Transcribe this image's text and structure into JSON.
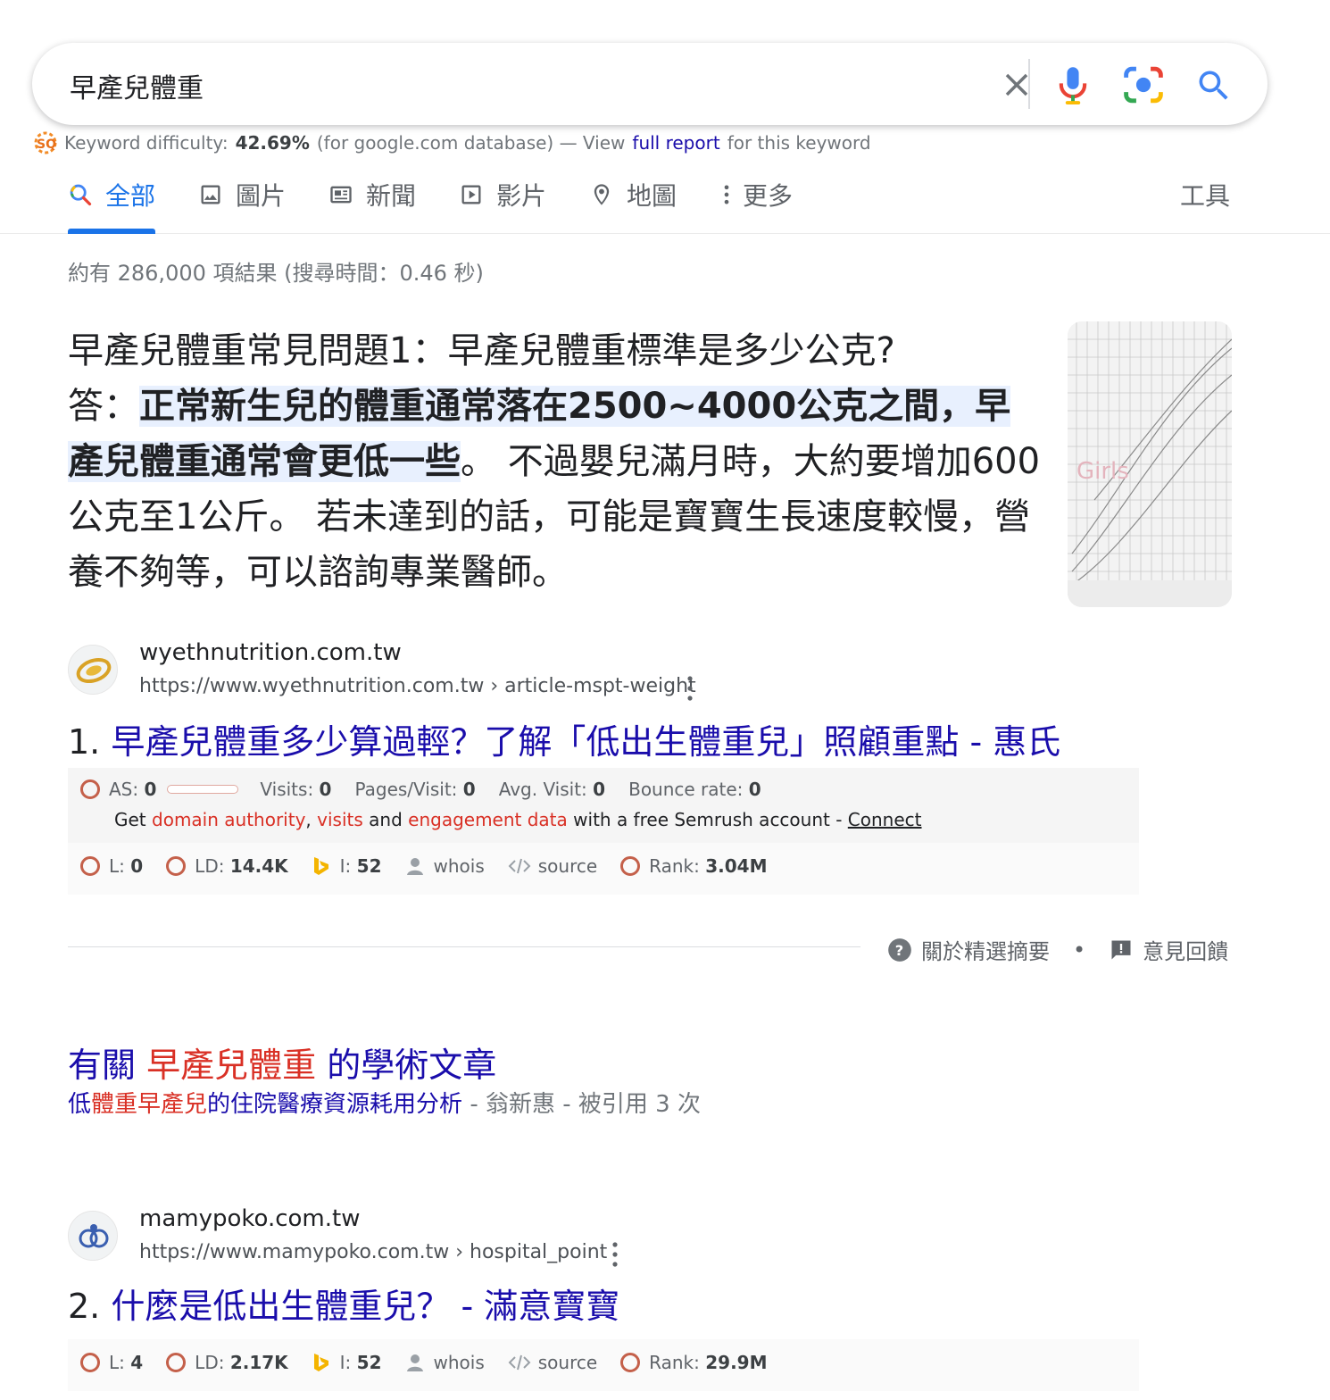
{
  "search": {
    "query": "早產兒體重"
  },
  "keyword_bar": {
    "prefix": "Keyword difficulty:",
    "value": "42.69%",
    "db": "(for google.com database) — View",
    "link": "full report",
    "suffix": "for this keyword"
  },
  "tabs": [
    {
      "label": "全部",
      "icon": "search-icon",
      "active": true
    },
    {
      "label": "圖片",
      "icon": "image-icon"
    },
    {
      "label": "新聞",
      "icon": "news-icon"
    },
    {
      "label": "影片",
      "icon": "video-icon"
    },
    {
      "label": "地圖",
      "icon": "map-pin-icon"
    },
    {
      "label": "更多",
      "icon": "more-vert-icon"
    }
  ],
  "tools_label": "工具",
  "result_stats": "約有 286,000 項結果 (搜尋時間：0.46 秒)",
  "snippet": {
    "line1": "早產兒體重常見問題1：早產兒體重標準是多少公克?",
    "answer_prefix": "答：",
    "highlight": "正常新生兒的體重通常落在2500~4000公克之間，早產兒體重通常會更低一些",
    "rest": "。 不過嬰兒滿月時，大約要增加600公克至1公斤。 若未達到的話，可能是寶寶生長速度較慢，營養不夠等，可以諮詢專業醫師。",
    "image_label": "Girls"
  },
  "results": [
    {
      "site_name": "wyethnutrition.com.tw",
      "url": "https://www.wyethnutrition.com.tw › article-mspt-weight",
      "number": "1.",
      "title": "早產兒體重多少算過輕？了解「低出生體重兒」照顧重點 - 惠氏",
      "as": "0",
      "visits": "0",
      "pages_visit": "0",
      "avg_visit": "0",
      "bounce": "0",
      "l": "0",
      "ld": "14.4K",
      "i": "52",
      "rank": "3.04M"
    },
    {
      "site_name": "mamypoko.com.tw",
      "url": "https://www.mamypoko.com.tw › hospital_point",
      "number": "2.",
      "title": "什麼是低出生體重兒？ - 滿意寶寶",
      "l": "4",
      "ld": "2.17K",
      "i": "52",
      "rank": "29.9M"
    }
  ],
  "semrush_labels": {
    "as": "AS:",
    "visits": "Visits:",
    "pages_visit": "Pages/Visit:",
    "avg_visit": "Avg. Visit:",
    "bounce": "Bounce rate:",
    "get": "Get",
    "domain_authority": "domain authority",
    "comma": ",",
    "visits_link": "visits",
    "and": "and",
    "engagement": "engagement data",
    "with_free": "with a free Semrush account -",
    "connect": "Connect",
    "l": "L:",
    "ld": "LD:",
    "i": "I:",
    "whois": "whois",
    "source": "source",
    "rank": "Rank:"
  },
  "snippet_footer": {
    "about": "關於精選摘要",
    "dot": "•",
    "feedback": "意見回饋"
  },
  "scholar": {
    "title_prefix": "有關",
    "title_query": "早產兒體重",
    "title_suffix": "的學術文章",
    "item_pre": "低",
    "item_q1": "體重早產兒",
    "item_post": "的住院醫療資源耗用分析",
    "item_meta": "- 翁新惠 - 被引用 3 次"
  },
  "colors": {
    "link": "#1a0dab",
    "accent": "#1a73e8",
    "semrush": "#c4604a",
    "highlight_bg": "#e8f0fe"
  }
}
